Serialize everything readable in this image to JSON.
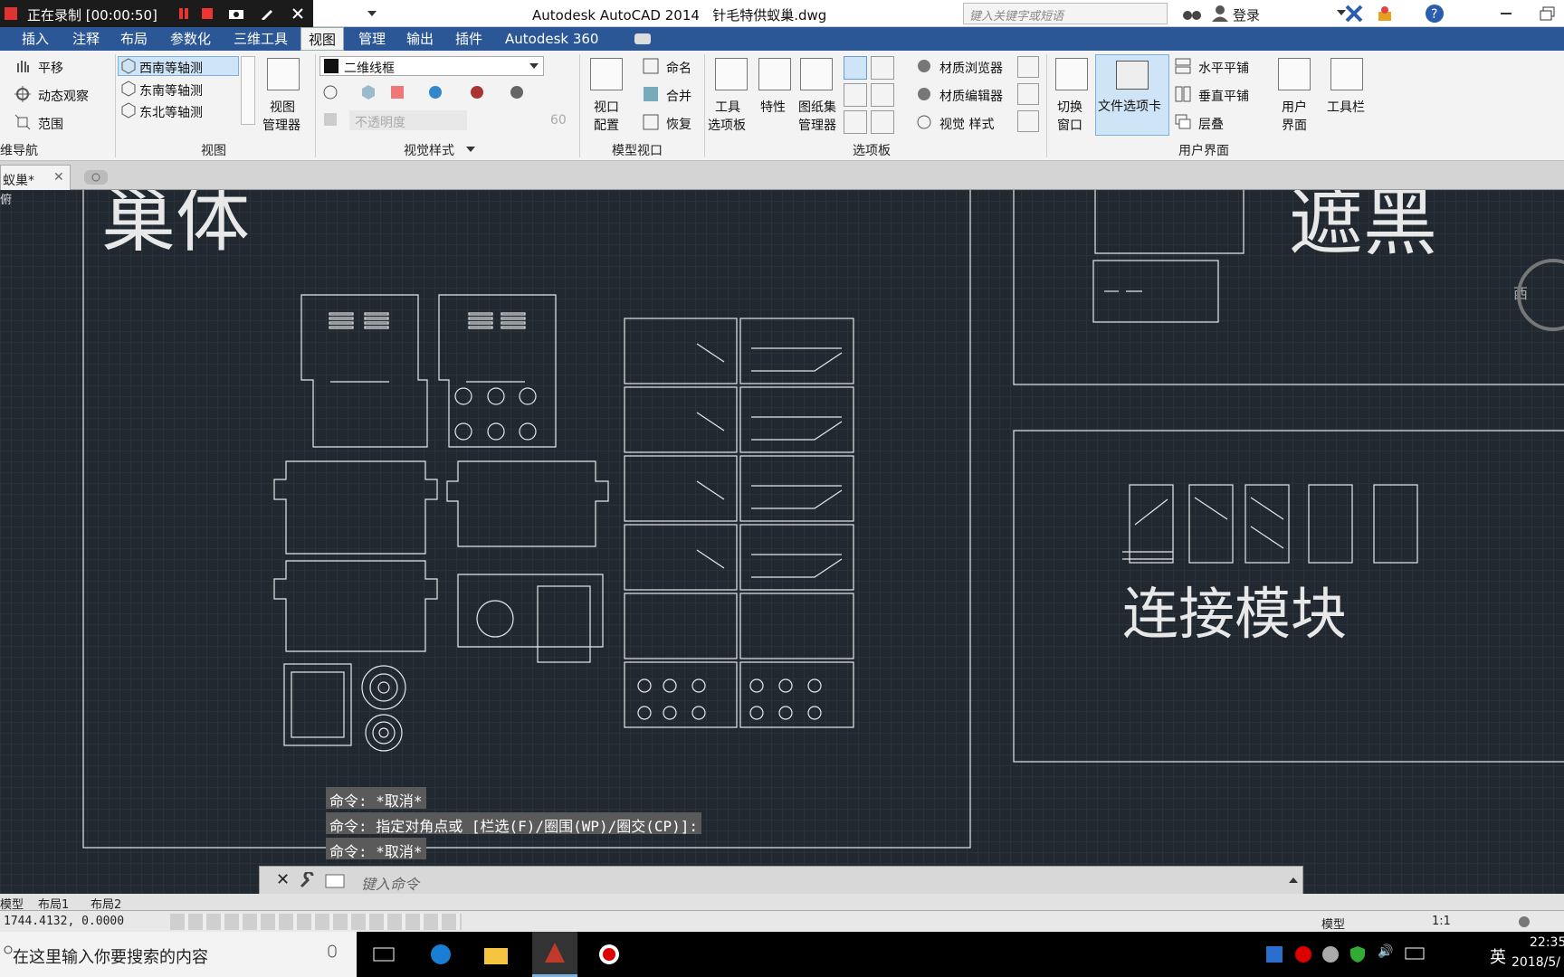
{
  "recorder": {
    "status": "正在录制 [00:00:50]"
  },
  "title": {
    "app": "Autodesk AutoCAD 2014",
    "file": "针毛特供蚁巢.dwg"
  },
  "search": {
    "placeholder": "键入关键字或短语"
  },
  "account": {
    "login": "登录"
  },
  "menu": {
    "tabs": [
      "插入",
      "注释",
      "布局",
      "参数化",
      "三维工具",
      "视图",
      "管理",
      "输出",
      "插件",
      "Autodesk 360"
    ],
    "active": "视图"
  },
  "ribbon": {
    "nav": {
      "items": [
        "平移",
        "动态观察",
        "范围"
      ],
      "label": "维导航"
    },
    "views": {
      "items": [
        "西南等轴测",
        "东南等轴测",
        "东北等轴测"
      ],
      "manager": [
        "视图",
        "管理器"
      ],
      "label": "视图"
    },
    "visual": {
      "style": "二维线框",
      "opacity_placeholder": "不透明度",
      "opacity_value": "60",
      "label": "视觉样式"
    },
    "model_viewport": {
      "config": [
        "视口",
        "配置"
      ],
      "items": [
        "命名",
        "合并",
        "恢复"
      ],
      "label": "模型视口"
    },
    "palettes": {
      "items": [
        [
          "工具",
          "选项板"
        ],
        [
          "特性"
        ],
        [
          "图纸集",
          "管理器"
        ]
      ],
      "small": [
        "材质浏览器",
        "材质编辑器",
        "视觉 样式"
      ],
      "label": "选项板"
    },
    "ui": {
      "switch": [
        "切换",
        "窗口"
      ],
      "filetabs": "文件选项卡",
      "tile": [
        "水平平铺",
        "垂直平铺",
        "层叠"
      ],
      "user": [
        "用户",
        "界面"
      ],
      "toolbar": "工具栏",
      "label": "用户界面"
    }
  },
  "doc": {
    "tab": "蚁巢*",
    "viewport_label": "俯"
  },
  "drawing": {
    "text1": "巢体",
    "text2": "遮黑",
    "text3": "连接模块",
    "compass": "西"
  },
  "command": {
    "lines": [
      "命令: *取消*",
      "命令: 指定对角点或 [栏选(F)/圈围(WP)/圈交(CP)]:",
      "命令: *取消*"
    ],
    "placeholder": "键入命令"
  },
  "layouts": [
    "模型",
    "布局1",
    "布局2"
  ],
  "status": {
    "coords": "1744.4132, 0.0000",
    "model": "模型",
    "scale": "1:1"
  },
  "taskbar": {
    "search": "在这里输入你要搜索的内容",
    "lang": "英",
    "time": "22:35",
    "date": "2018/5/"
  },
  "colors": {
    "canvas": "#212830",
    "menubar": "#2b5797",
    "ribbon": "#f3f3f3",
    "lines": "#e8e8e8"
  }
}
